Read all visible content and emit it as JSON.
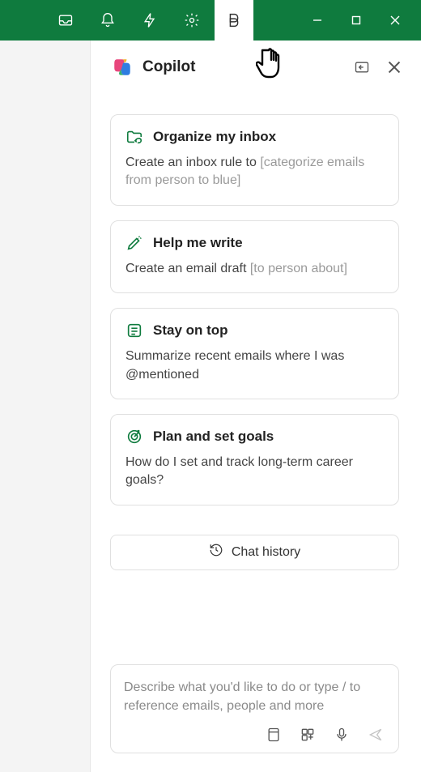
{
  "pane": {
    "title": "Copilot"
  },
  "suggestions": [
    {
      "title": "Organize my inbox",
      "body": "Create an inbox rule to ",
      "hint": "[categorize emails from person to blue]",
      "iconColor": "#0f7b3e"
    },
    {
      "title": "Help me write",
      "body": "Create an email draft ",
      "hint": "[to person about]",
      "iconColor": "#0f7b3e"
    },
    {
      "title": "Stay on top",
      "body": "Summarize recent emails where I was @mentioned",
      "hint": "",
      "iconColor": "#0f7b3e"
    },
    {
      "title": "Plan and set goals",
      "body": "How do I set and track long-term career goals?",
      "hint": "",
      "iconColor": "#0f7b3e"
    }
  ],
  "chatHistoryLabel": "Chat history",
  "input": {
    "placeholder": "Describe what you'd like to do or type / to reference emails, people and more"
  },
  "colors": {
    "brand": "#0f7b3e"
  }
}
